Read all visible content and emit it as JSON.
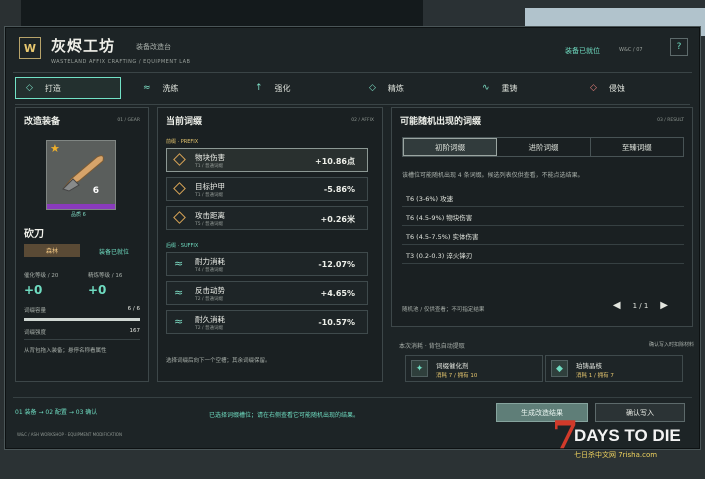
{
  "header": {
    "logo": "W",
    "title": "灰烬工坊",
    "subtitle_cn": "装备改造台",
    "subtitle_en": "WASTELAND AFFIX CRAFTING / EQUIPMENT LAB",
    "status": "装备已就位",
    "status_code": "W&C / 07",
    "help": "?"
  },
  "tabs": [
    {
      "icon": "◇",
      "label": "打造"
    },
    {
      "icon": "≈",
      "label": "洗练"
    },
    {
      "icon": "↑",
      "label": "强化"
    },
    {
      "icon": "◇",
      "label": "精炼"
    },
    {
      "icon": "∿",
      "label": "重铸"
    },
    {
      "icon": "◇",
      "label": "侵蚀"
    }
  ],
  "left": {
    "title": "改造装备",
    "code": "01 / GEAR",
    "item_count": "6",
    "quality": "品质 6",
    "item_name": "砍刀",
    "tag": "森林",
    "equipped": "装备已就位",
    "catalyst_label": "催化等级 / 20",
    "catalyst_value": "+0",
    "refine_label": "精炼等级 / 16",
    "refine_value": "+0",
    "capacity_label": "词缀容量",
    "capacity_value": "6 / 6",
    "capacity_fraction": 1.0,
    "strength_label": "词缀强度",
    "strength_value": "167",
    "hint": "从背包拖入装备；悬停名称看属性"
  },
  "middle": {
    "title": "当前词缀",
    "code": "02 / AFFIX",
    "prefix_label": "前缀 · PREFIX",
    "suffix_label": "后缀 · SUFFIX",
    "prefixes": [
      {
        "name": "物块伤害",
        "sub": "T1 / 普通词缀",
        "value": "+10.86点"
      },
      {
        "name": "目标护甲",
        "sub": "T1 / 普通词缀",
        "value": "-5.86%"
      },
      {
        "name": "攻击距离",
        "sub": "T5 / 普通词缀",
        "value": "+0.26米"
      }
    ],
    "suffixes": [
      {
        "name": "耐力消耗",
        "sub": "T4 / 普通词缀",
        "value": "-12.07%"
      },
      {
        "name": "反击动势",
        "sub": "T2 / 普通词缀",
        "value": "+4.65%"
      },
      {
        "name": "耐久消耗",
        "sub": "T2 / 普通词缀",
        "value": "-10.57%"
      }
    ],
    "hint": "选择词缀后向下一个空槽；其余词缀保留。"
  },
  "right": {
    "title": "可能随机出现的词缀",
    "code": "03 / RESULT",
    "subtabs": [
      "初阶词缀",
      "进阶词缀",
      "至臻词缀"
    ],
    "desc": "该槽位可能随机出现 4 条词缀。候选列表仅供查看，不能点选结果。",
    "pool": [
      "T6 (3-6%) 攻速",
      "T6 (4.5-9%) 物块伤害",
      "T6 (4.5-7.5%) 实体伤害",
      "T3 (0.2-0.3) 淬火锋刃"
    ],
    "pager_note": "随机池 / 仅供查看；不可指定结果",
    "page": "1 / 1"
  },
  "cost": {
    "title": "本次消耗 · 背包自动提取",
    "right_note": "确认写入时扣除材料",
    "materials": [
      {
        "name": "词缀催化剂",
        "qty": "消耗 7 / 拥有 10"
      },
      {
        "name": "珀铸晶核",
        "qty": "消耗 1 / 拥有 7"
      }
    ]
  },
  "footer": {
    "breadcrumb": "01 装备 → 02 配置 → 03 确认",
    "message": "已选择词缀槽位；请在右侧查看它可能随机出现的结果。",
    "generate": "生成改造结果",
    "confirm": "确认写入",
    "en": "W&C / ASH WORKSHOP · EQUIPMENT MODIFICATION"
  },
  "watermark": {
    "title": "DAYS TO DIE",
    "sub": "七日杀中文网 7risha.com",
    "seven": "7"
  }
}
